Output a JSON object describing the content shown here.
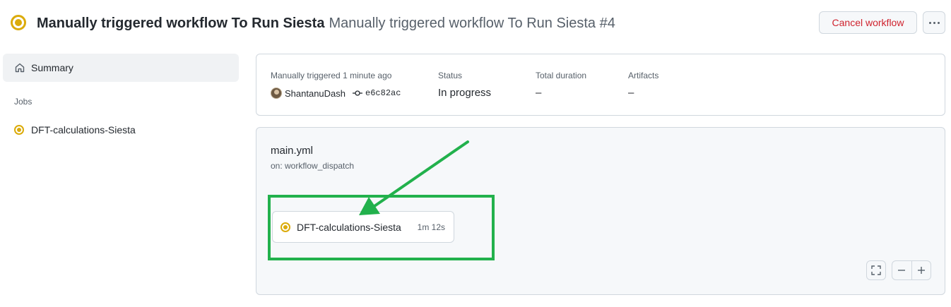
{
  "header": {
    "title": "Manually triggered workflow To Run Siesta",
    "subtitle": "Manually triggered workflow To Run Siesta #4",
    "cancel_label": "Cancel workflow",
    "status_icon": "in-progress-icon"
  },
  "sidebar": {
    "summary_label": "Summary",
    "jobs_heading": "Jobs",
    "jobs": [
      {
        "label": "DFT-calculations-Siesta",
        "status": "in-progress"
      }
    ]
  },
  "summary": {
    "trigger_label": "Manually triggered",
    "trigger_time": "1 minute ago",
    "actor": "ShantanuDash",
    "commit": "e6c82ac",
    "status_label": "Status",
    "status_value": "In progress",
    "duration_label": "Total duration",
    "duration_value": "–",
    "artifacts_label": "Artifacts",
    "artifacts_value": "–"
  },
  "graph": {
    "file": "main.yml",
    "trigger": "on: workflow_dispatch",
    "job": {
      "name": "DFT-calculations-Siesta",
      "duration": "1m 12s"
    }
  },
  "colors": {
    "in_progress": "#dbab0a",
    "danger": "#cf222e",
    "annotation": "#22b14c"
  }
}
